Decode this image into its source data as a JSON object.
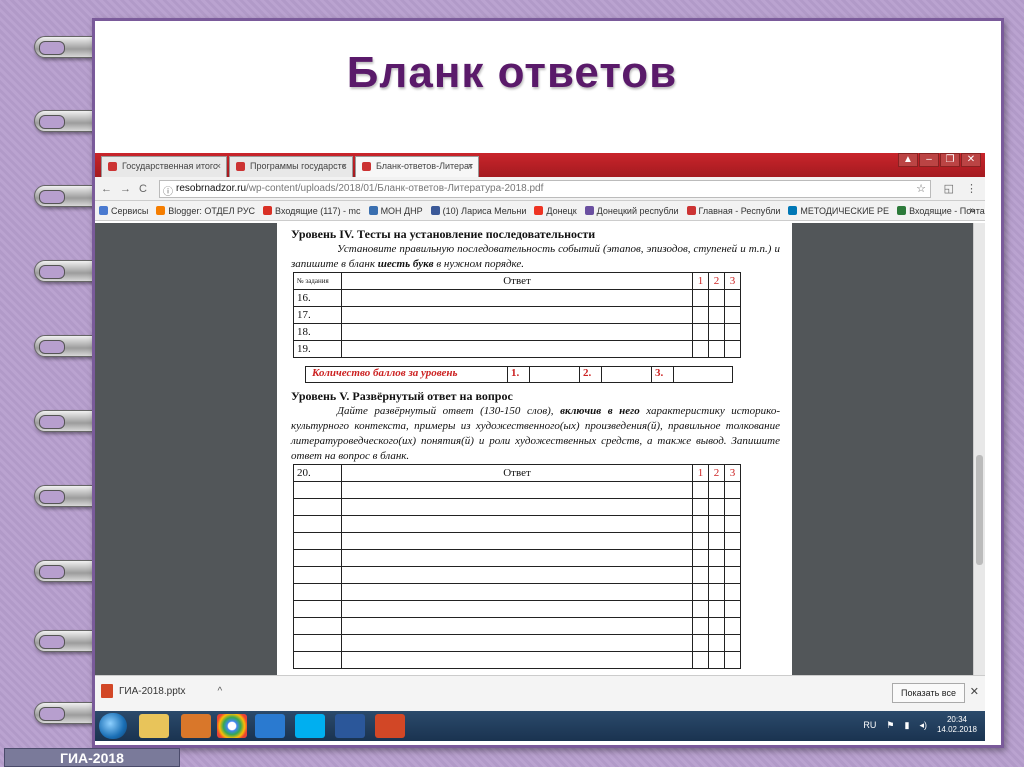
{
  "slide": {
    "title": "Бланк ответов",
    "badge": "ГИА-2018"
  },
  "browser": {
    "tabs": [
      "Государственная итогс",
      "Программы государстс",
      "Бланк-ответов-Литерат"
    ],
    "url_host": "resobrnadzor.ru",
    "url_path": "/wp-content/uploads/2018/01/Бланк-ответов-Литература-2018.pdf",
    "bookmarks": [
      "Сервисы",
      "Blogger: ОТДЕЛ РУС",
      "Входящие (117) - mc",
      "МОН ДНР",
      "(10) Лариса Мельни",
      "Донецк",
      "Донецкий республи",
      "Главная - Республи",
      "МЕТОДИЧЕСКИЕ РЕ",
      "Входящие - Почта"
    ]
  },
  "pdf": {
    "level4": {
      "heading": "Уровень IV. Тесты на установление последовательности",
      "instr_a": "Установите правильную последовательность событий (этапов, эпизодов, ступеней и т.п.) и запишите в бланк ",
      "instr_bold": "шесть букв",
      "instr_b": " в нужном порядке.",
      "rows": [
        "16.",
        "17.",
        "18.",
        "19."
      ]
    },
    "table_no_header": "№ задания",
    "answer_header": "Ответ",
    "score_cols": [
      "1",
      "2",
      "3"
    ],
    "score_label": "Количество баллов за уровень",
    "score_marks": [
      "1.",
      "2.",
      "3."
    ],
    "level5": {
      "heading": "Уровень V. Развёрнутый ответ на вопрос",
      "instr_a": "Дайте развёрнутый ответ (130-150 слов), ",
      "instr_bold": "включив в него",
      "instr_b": " характеристику историко-культурного контекста, примеры из художественного(ых) произведения(й), правильное толкование литературоведческого(их) понятия(й) и роли художественных средств, а также вывод. Запишите ответ на вопрос в бланк.",
      "task_no": "20."
    }
  },
  "downloads": {
    "file": "ГИА-2018.pptx",
    "show_all": "Показать все"
  },
  "taskbar": {
    "lang": "RU",
    "time": "20:34",
    "date": "14.02.2018"
  }
}
